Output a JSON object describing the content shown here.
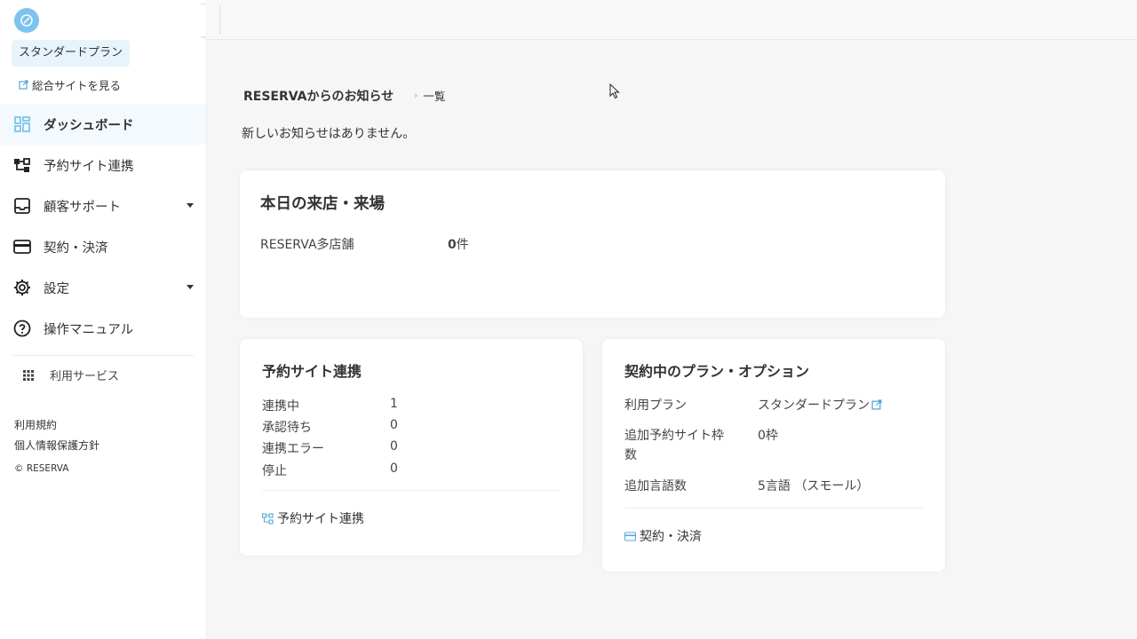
{
  "sidebar": {
    "plan_badge": "スタンダードプラン",
    "site_link": "総合サイトを見る",
    "nav": [
      {
        "label": "ダッシュボード",
        "icon": "dashboard-icon"
      },
      {
        "label": "予約サイト連携",
        "icon": "site-link-icon"
      },
      {
        "label": "顧客サポート",
        "icon": "inbox-icon"
      },
      {
        "label": "契約・決済",
        "icon": "credit-card-icon"
      },
      {
        "label": "設定",
        "icon": "gear-icon"
      },
      {
        "label": "操作マニュアル",
        "icon": "help-icon"
      }
    ],
    "services": "利用サービス",
    "footer": {
      "terms": "利用規約",
      "privacy": "個人情報保護方針",
      "copyright": "© RESERVA"
    }
  },
  "news": {
    "title": "RESERVAからのお知らせ",
    "list_link": "一覧",
    "empty": "新しいお知らせはありません。"
  },
  "today": {
    "title": "本日の来店・来場",
    "store": "RESERVA多店舗",
    "count": "0",
    "unit": "件"
  },
  "site_link_card": {
    "title": "予約サイト連携",
    "rows": [
      {
        "label": "連携中",
        "value": "1"
      },
      {
        "label": "承認待ち",
        "value": "0"
      },
      {
        "label": "連携エラー",
        "value": "0"
      },
      {
        "label": "停止",
        "value": "0"
      }
    ],
    "link": "予約サイト連携"
  },
  "plan_card": {
    "title": "契約中のプラン・オプション",
    "plan_label": "利用プラン",
    "plan_value": "スタンダードプラン",
    "extra_sites_label_1": "追加予約サイト枠",
    "extra_sites_label_2": "数",
    "extra_sites_value": "0枠",
    "languages_label": "追加言語数",
    "languages_value": "5言語 （スモール）",
    "link": "契約・決済"
  },
  "colors": {
    "accent": "#7cc4ef",
    "active_bg": "#e8f4fb"
  }
}
